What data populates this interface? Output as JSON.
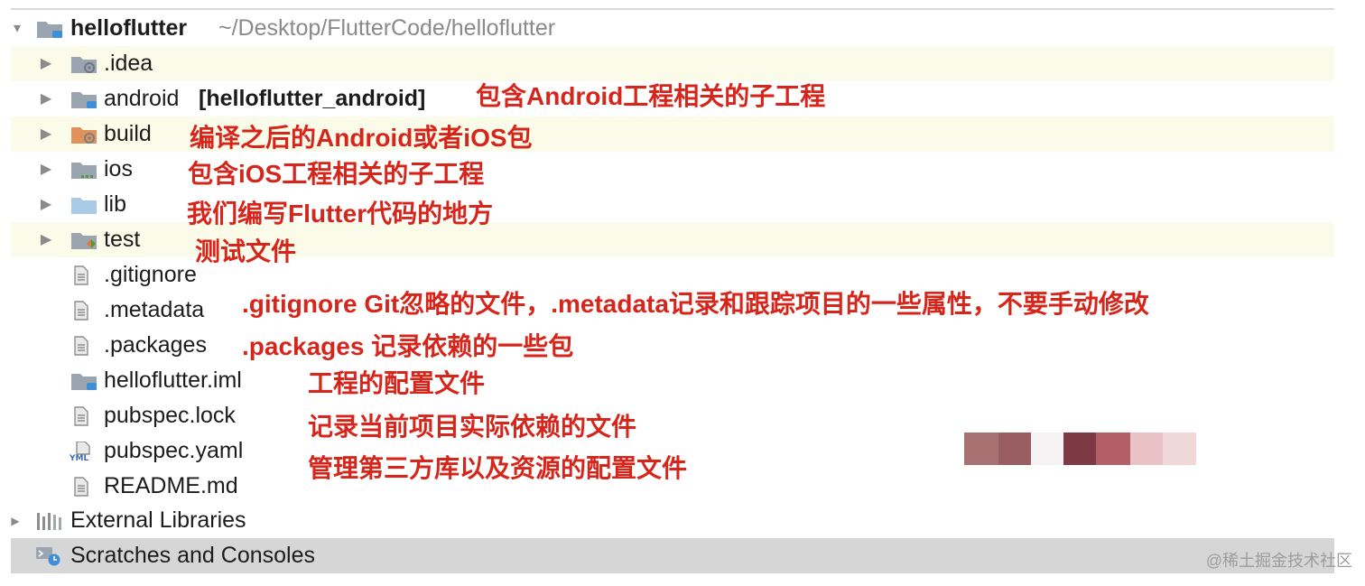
{
  "project": {
    "name": "helloflutter",
    "path": "~/Desktop/FlutterCode/helloflutter"
  },
  "tree": [
    {
      "label": ".idea",
      "icon": "idea-folder-icon"
    },
    {
      "label": "android",
      "module": "[helloflutter_android]",
      "icon": "android-module-folder-icon"
    },
    {
      "label": "build",
      "icon": "build-folder-icon"
    },
    {
      "label": "ios",
      "icon": "ios-folder-icon"
    },
    {
      "label": "lib",
      "icon": "source-folder-icon"
    },
    {
      "label": "test",
      "icon": "test-folder-icon"
    },
    {
      "label": ".gitignore",
      "icon": "text-file-icon"
    },
    {
      "label": ".metadata",
      "icon": "text-file-icon"
    },
    {
      "label": ".packages",
      "icon": "text-file-icon"
    },
    {
      "label": "helloflutter.iml",
      "icon": "module-file-icon"
    },
    {
      "label": "pubspec.lock",
      "icon": "text-file-icon"
    },
    {
      "label": "pubspec.yaml",
      "icon": "yaml-file-icon"
    },
    {
      "label": "README.md",
      "icon": "text-file-icon"
    }
  ],
  "external_libraries": "External Libraries",
  "scratches": "Scratches and Consoles",
  "annotations": {
    "android": "包含Android工程相关的子工程",
    "build": "编译之后的Android或者iOS包",
    "ios": "包含iOS工程相关的子工程",
    "lib": "我们编写Flutter代码的地方",
    "test": "测试文件",
    "gitignore_metadata": ".gitignore Git忽略的文件，.metadata记录和跟踪项目的一些属性，不要手动修改",
    "packages": ".packages 记录依赖的一些包",
    "iml": "工程的配置文件",
    "lock": "记录当前项目实际依赖的文件",
    "yaml": "管理第三方库以及资源的配置文件"
  },
  "watermark": "@稀土掘金技术社区",
  "colors": {
    "annotation": "#d6261c",
    "highlight_row": "#fbfbe9",
    "selected_row": "#d6d6d6",
    "folder": "#9aa5b1",
    "source_folder": "#a9cbe6"
  }
}
